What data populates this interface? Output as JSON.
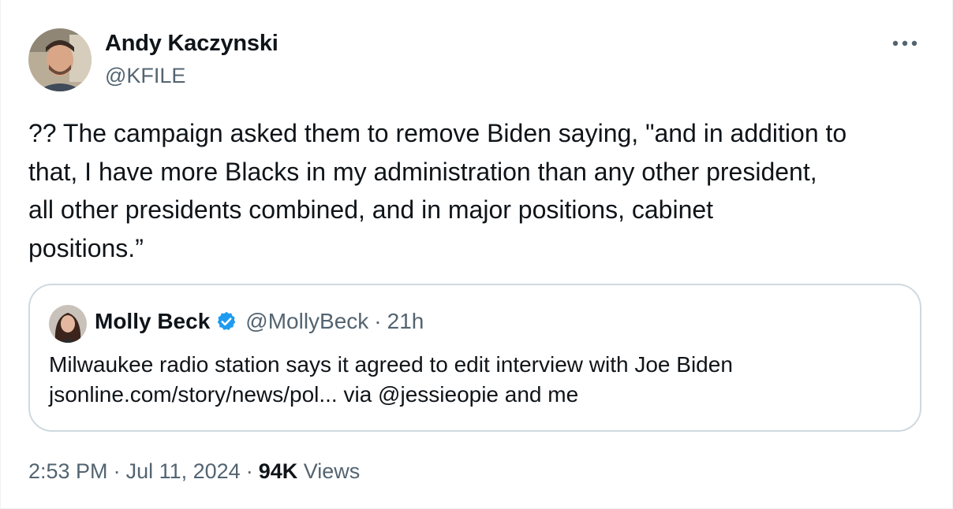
{
  "author": {
    "name": "Andy Kaczynski",
    "handle": "@KFILE"
  },
  "tweet": {
    "text": "?? The campaign asked them to remove Biden saying, \"and in addition to\nthat, I have more Blacks in my administration than any other president,\nall other presidents combined, and in major positions, cabinet\npositions.”"
  },
  "quoted_tweet": {
    "name": "Molly Beck",
    "handle": "@MollyBeck",
    "separator": "·",
    "time": "21h",
    "text": "Milwaukee radio station says it agreed to edit interview with Joe Biden\njsonline.com/story/news/pol... via @jessieopie and me"
  },
  "footer": {
    "time": "2:53 PM",
    "separator": "·",
    "date": "Jul 11, 2024",
    "views_count": "94K",
    "views_label": "Views"
  },
  "icons": {
    "more": "more-horizontal-icon",
    "verified": "verified-badge-icon"
  },
  "colors": {
    "text_primary": "#0f1419",
    "text_secondary": "#536471",
    "border": "#cfd9de",
    "verified_blue": "#1d9bf0"
  }
}
